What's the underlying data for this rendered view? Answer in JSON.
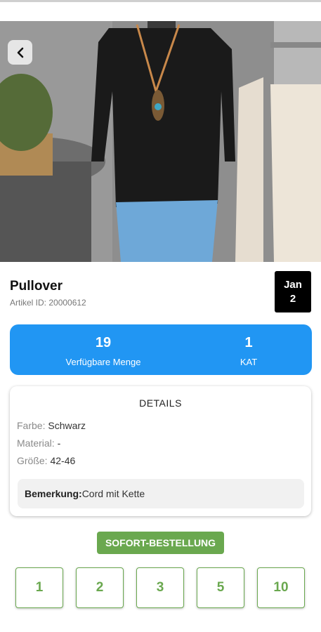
{
  "product": {
    "title": "Pullover",
    "article_id": "Artikel ID: 20000612",
    "date_month": "Jan",
    "date_day": "2"
  },
  "stats": {
    "quantity_value": "19",
    "quantity_label": "Verfügbare Menge",
    "kat_value": "1",
    "kat_label": "KAT"
  },
  "details": {
    "heading": "DETAILS",
    "color_label": "Farbe:",
    "color_value": "Schwarz",
    "material_label": "Material:",
    "material_value": "-",
    "size_label": "Größe:",
    "size_value": "42-46",
    "remark_label": "Bemerkung:",
    "remark_value": "Cord mit Kette"
  },
  "order": {
    "label": "SOFORT-BESTELLUNG",
    "quantities": [
      "1",
      "2",
      "3",
      "5",
      "10"
    ]
  },
  "colors": {
    "stats_blue": "#2196f3",
    "order_green": "#6aa84f"
  },
  "icons": {
    "back": "chevron-left-icon"
  }
}
